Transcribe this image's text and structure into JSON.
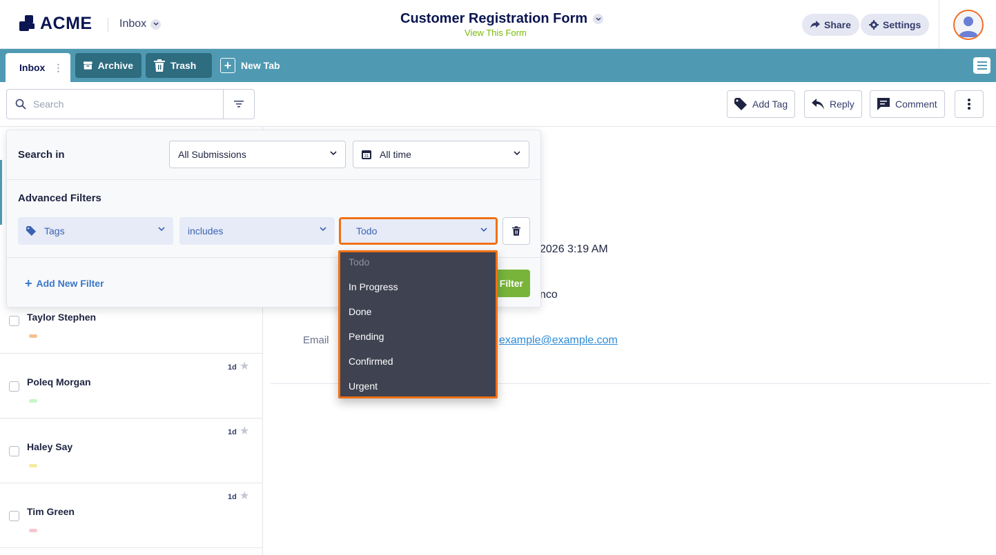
{
  "header": {
    "logo_text": "ACME",
    "inbox_label": "Inbox",
    "form_title": "Customer Registration Form",
    "form_subtitle": "View This Form",
    "share_label": "Share",
    "settings_label": "Settings"
  },
  "tabs": [
    {
      "label": "Inbox"
    },
    {
      "label": "Archive"
    },
    {
      "label": "Trash"
    },
    {
      "label": "New Tab"
    }
  ],
  "toolbar": {
    "search_placeholder": "Search",
    "add_tag_label": "Add Tag",
    "reply_label": "Reply",
    "comment_label": "Comment"
  },
  "filter_panel": {
    "search_in_label": "Search in",
    "scope_value": "All Submissions",
    "date_value": "All time",
    "advanced_label": "Advanced Filters",
    "field_value": "Tags",
    "operator_value": "includes",
    "value_selected": "Todo",
    "add_filter_label": "Add New Filter",
    "apply_label": "Filter"
  },
  "dropdown": {
    "options": [
      "Todo",
      "In Progress",
      "Done",
      "Pending",
      "Confirmed",
      "Urgent"
    ]
  },
  "list": {
    "items": [
      {
        "name": "Taylor Stephen",
        "time": "",
        "tag_color": "#f7c08a"
      },
      {
        "name": "Poleq Morgan",
        "time": "1d",
        "tag_color": "#c8f5c8"
      },
      {
        "name": "Haley Say",
        "time": "1d",
        "tag_color": "#f3ec9e"
      },
      {
        "name": "Tim Green",
        "time": "1d",
        "tag_color": "#f6c6d0"
      }
    ]
  },
  "detail": {
    "date_partial": "2026 3:19 AM",
    "city_partial": "nco",
    "email_label": "Email",
    "email_value": "example@example.com"
  }
}
